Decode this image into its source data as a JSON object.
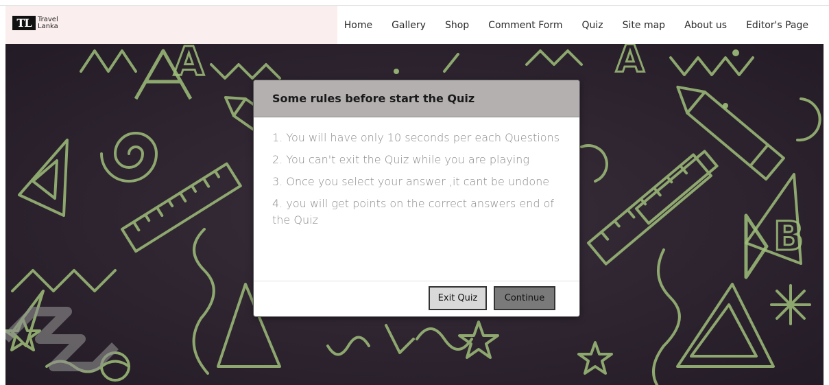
{
  "brand": {
    "mark": "TL",
    "line1": "Travel",
    "line2": "Lanka"
  },
  "nav": {
    "items": [
      {
        "label": "Home"
      },
      {
        "label": "Gallery"
      },
      {
        "label": "Shop"
      },
      {
        "label": "Comment Form"
      },
      {
        "label": "Quiz"
      },
      {
        "label": "Site map"
      },
      {
        "label": "About us"
      },
      {
        "label": "Editor's Page"
      }
    ]
  },
  "modal": {
    "title": "Some rules before start the Quiz",
    "rules": [
      "1. You will have only 10 seconds per each Questions",
      "2. You can't exit the Quiz while you are playing",
      "3. Once you select your answer ,it cant be undone",
      "4. you will get points on the correct answers end of the Quiz"
    ],
    "exit_label": "Exit Quiz",
    "continue_label": "Continue"
  },
  "background": {
    "glyph_a": "A",
    "glyph_b": "B"
  },
  "colors": {
    "navbar_brand_bg": "#fbeeee",
    "hero_bg": "#2e2430",
    "chalk_green": "#9fbf7a",
    "modal_header_bg": "#b4b0b0",
    "exit_button_bg": "#d9d9d9",
    "continue_button_bg": "#7a7a7a"
  }
}
